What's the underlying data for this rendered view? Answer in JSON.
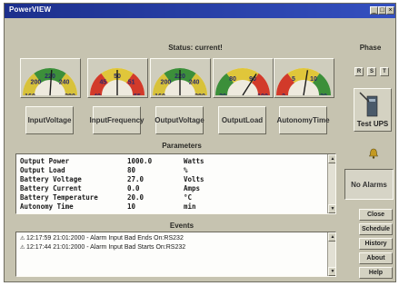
{
  "window": {
    "title": "PowerVIEW",
    "min_glyph": "_",
    "max_glyph": "□",
    "close_glyph": "×"
  },
  "status": {
    "title": "Status: current!"
  },
  "gauges": [
    {
      "name": "input-voltage-gauge",
      "ticks": [
        "160",
        "200",
        "220",
        "240",
        "280"
      ],
      "value_fraction": 0.52,
      "label_line1": "Input",
      "label_line2": "Voltage",
      "zones": [
        "#d8c23a",
        "#3c8f3a",
        "#d8c23a"
      ]
    },
    {
      "name": "input-frequency-gauge",
      "ticks": [
        "40",
        "45",
        "50",
        "51",
        "55"
      ],
      "value_fraction": 0.5,
      "label_line1": "Input",
      "label_line2": "Frequency",
      "zones": [
        "#d23a2a",
        "#e0c63a",
        "#d23a2a"
      ]
    },
    {
      "name": "output-voltage-gauge",
      "ticks": [
        "160",
        "200",
        "220",
        "240",
        "280"
      ],
      "value_fraction": 0.5,
      "label_line1": "Output",
      "label_line2": "Voltage",
      "zones": [
        "#d8c23a",
        "#3c8f3a",
        "#d8c23a"
      ]
    },
    {
      "name": "output-load-gauge",
      "ticks": [
        "20",
        "80",
        "90",
        "100"
      ],
      "value_fraction": 0.68,
      "label_line1": "Output",
      "label_line2": "Load",
      "zones": [
        "#3c8f3a",
        "#e0c63a",
        "#d23a2a"
      ]
    },
    {
      "name": "autonomy-time-gauge",
      "ticks": [
        "2",
        "5",
        "10",
        "20"
      ],
      "value_fraction": 0.55,
      "label_line1": "Autonomy",
      "label_line2": "Time",
      "zones": [
        "#d23a2a",
        "#e0c63a",
        "#3c8f3a"
      ]
    }
  ],
  "phase": {
    "title": "Phase",
    "buttons": [
      "R",
      "S",
      "T"
    ]
  },
  "test_ups": {
    "label": "Test UPS"
  },
  "alarms": {
    "status": "No Alarms"
  },
  "parameters": {
    "title": "Parameters",
    "rows": [
      {
        "name": "Output Power",
        "value": "1000.0",
        "unit": "Watts"
      },
      {
        "name": "Output Load",
        "value": "80",
        "unit": "%"
      },
      {
        "name": "Battery Voltage",
        "value": "27.0",
        "unit": "Volts"
      },
      {
        "name": "Battery Current",
        "value": "0.0",
        "unit": "Amps"
      },
      {
        "name": "Battery Temperature",
        "value": "20.0",
        "unit": "°C"
      },
      {
        "name": "Autonomy Time",
        "value": "10",
        "unit": "min"
      }
    ]
  },
  "events": {
    "title": "Events",
    "rows": [
      "12:17:59 21:01:2000 - Alarm Input Bad Ends On:RS232",
      "12:17:44 21:01:2000 - Alarm Input Bad Starts On:RS232"
    ]
  },
  "side_buttons": [
    "Close",
    "Schedule",
    "History",
    "About",
    "Help"
  ]
}
